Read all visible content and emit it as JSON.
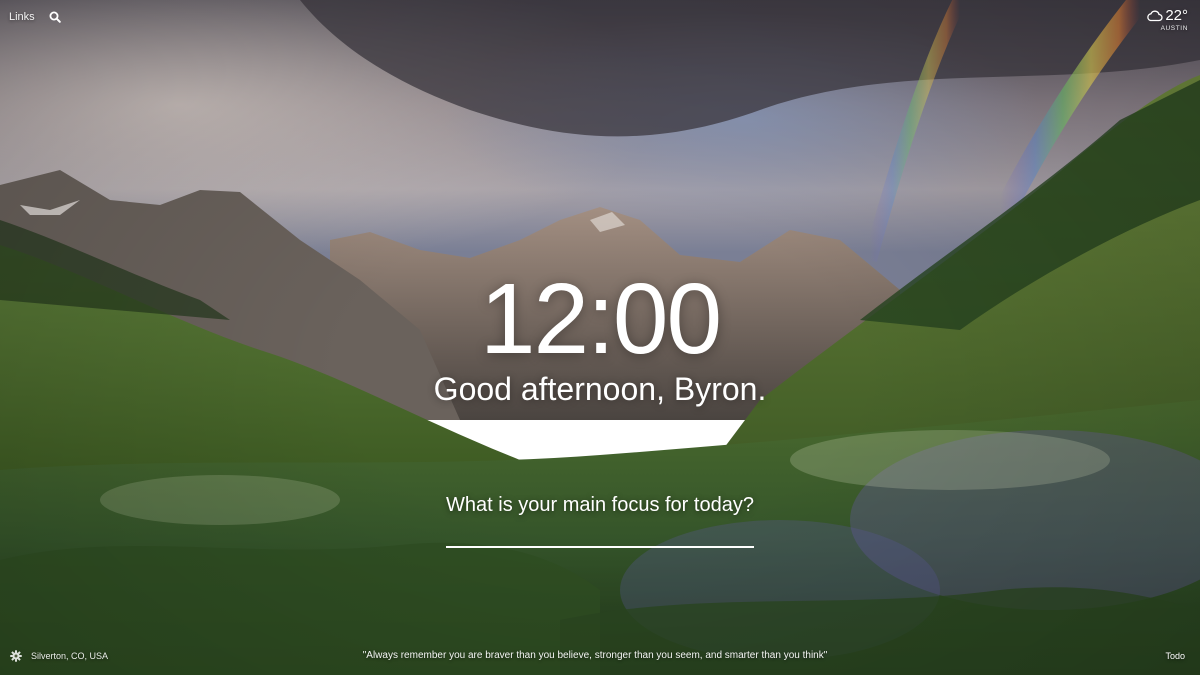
{
  "top_bar": {
    "links_label": "Links",
    "search_icon": "search-icon"
  },
  "weather": {
    "icon": "cloud-icon",
    "temperature": "22°",
    "location": "AUSTIN"
  },
  "clock": {
    "time": "12:00"
  },
  "greeting": {
    "text": "Good afternoon, Byron."
  },
  "focus": {
    "question": "What is your main focus for today?",
    "value": ""
  },
  "bottom_bar": {
    "settings_icon": "gear-icon",
    "photo_location": "Silverton, CO, USA",
    "quote": "\"Always remember you are braver than you believe, stronger than you seem, and smarter than you think\"",
    "todo_label": "Todo"
  },
  "colors": {
    "text": "#ffffff",
    "sky_top": "#5a5560",
    "meadow": "#4a6a2e",
    "flowers": "#6a5aa8"
  }
}
